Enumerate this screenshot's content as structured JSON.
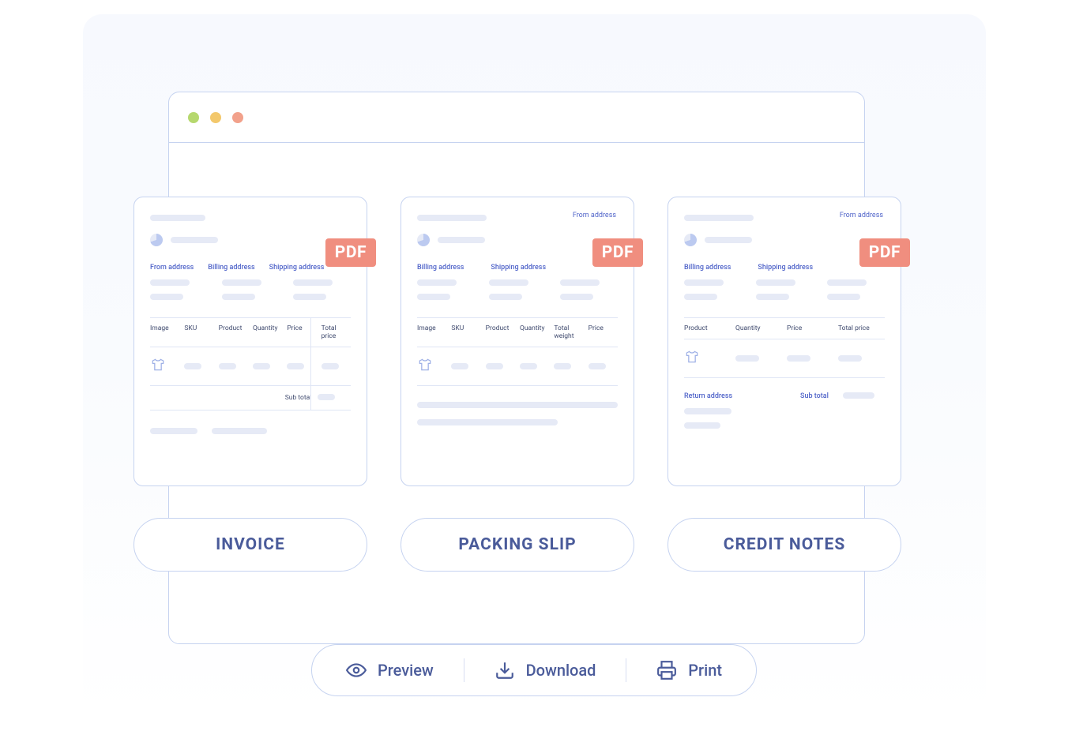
{
  "pdf_badge": "PDF",
  "labels": {
    "from_address": "From address",
    "billing_address": "Billing address",
    "shipping_address": "Shipping address",
    "return_address": "Return address",
    "sub_total": "Sub total"
  },
  "invoice": {
    "title": "INVOICE",
    "columns": [
      "Image",
      "SKU",
      "Product",
      "Quantity",
      "Price",
      "Total price"
    ]
  },
  "packing_slip": {
    "title": "PACKING SLIP",
    "columns": [
      "Image",
      "SKU",
      "Product",
      "Quantity",
      "Total weight",
      "Price"
    ]
  },
  "credit_notes": {
    "title": "CREDIT NOTES",
    "columns": [
      "Product",
      "Quantity",
      "Price",
      "Total price"
    ]
  },
  "actions": {
    "preview": "Preview",
    "download": "Download",
    "print": "Print"
  }
}
